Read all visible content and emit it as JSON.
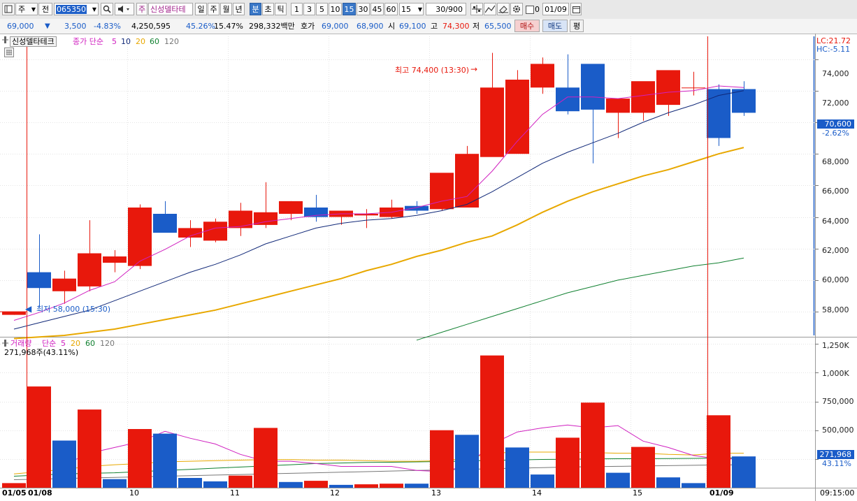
{
  "toolbar": {
    "type_label": "주",
    "period_label": "전",
    "code": "065350",
    "stock_name": "신성델타테",
    "stock_tag": "주",
    "period_buttons": [
      "일",
      "주",
      "월",
      "년",
      "분",
      "초",
      "틱"
    ],
    "interval_buttons": [
      "1",
      "3",
      "5",
      "10",
      "15",
      "30",
      "45",
      "60"
    ],
    "interval_value": "15",
    "count": "30/900",
    "count_checkbox_value": "0",
    "date": "01/09"
  },
  "quote": {
    "price": "69,000",
    "change": "3,500",
    "change_pct": "-4.83%",
    "volume": "4,250,595",
    "rate1": "45.26%",
    "rate2": "15.47%",
    "amount": "298,332백만",
    "ask_label": "호가",
    "ask": "69,000",
    "bid": "68,900",
    "open_label": "시",
    "open": "69,100",
    "high_label": "고",
    "high": "74,300",
    "low_label": "저",
    "low": "65,500",
    "buy_button": "매수",
    "sell_button": "매도",
    "eval_button": "평"
  },
  "price_panel": {
    "stock_label": "신성델타테크",
    "legend_prefix": "종가 단순",
    "legend_ma": [
      {
        "period": "5",
        "color": "#d020c0"
      },
      {
        "period": "10",
        "color": "#102878"
      },
      {
        "period": "20",
        "color": "#e8a800"
      },
      {
        "period": "60",
        "color": "#108030"
      },
      {
        "period": "120",
        "color": "#777777"
      }
    ],
    "max_annotation": "최고 74,400 (13:30)",
    "min_annotation": "최저 58,000 (15:30)",
    "lc_label": "LC:21.72",
    "hc_label": "HC:-5.11",
    "last_price_tag": "70,600",
    "last_change_tag": "-2.62%",
    "y_ticks": [
      "74,000",
      "72,000",
      "70,000",
      "68,000",
      "66,000",
      "64,000",
      "62,000",
      "60,000",
      "58,000"
    ]
  },
  "volume_panel": {
    "legend_title": "거래량",
    "legend_prefix": "단순",
    "legend_ma": [
      {
        "period": "5",
        "color": "#d020c0"
      },
      {
        "period": "20",
        "color": "#e8a800"
      },
      {
        "period": "60",
        "color": "#108030"
      },
      {
        "period": "120",
        "color": "#777777"
      }
    ],
    "info": "271,968주(43.11%)",
    "last_volume_tag": "271,968",
    "last_pct_tag": "43.11%",
    "y_ticks": [
      "1,250K",
      "1,000K",
      "750,000",
      "500,000",
      "250,000"
    ]
  },
  "x_axis": {
    "ticks": [
      "01/05",
      "01/08",
      "10",
      "11",
      "12",
      "13",
      "14",
      "15",
      "01/09"
    ],
    "time_label": "09:15:00"
  },
  "colors": {
    "up": "#e8180c",
    "down": "#1a5cc8",
    "ma5": "#d020c0",
    "ma10": "#102878",
    "ma20": "#e8a800",
    "ma60": "#108030",
    "ma120": "#777777"
  },
  "chart_data": [
    {
      "type": "candlestick",
      "title": "신성델타테크",
      "interval": "15",
      "categories": [
        "01/05 15:15",
        "01/08 09:00",
        "01/08 09:15",
        "01/08 09:30",
        "01/08 09:45",
        "01/08 10:00",
        "01/08 10:15",
        "01/08 10:30",
        "01/08 10:45",
        "01/08 11:00",
        "01/08 11:15",
        "01/08 11:30",
        "01/08 11:45",
        "01/08 12:00",
        "01/08 12:15",
        "01/08 12:30",
        "01/08 12:45",
        "01/08 13:00",
        "01/08 13:15",
        "01/08 13:30",
        "01/08 13:45",
        "01/08 14:00",
        "01/08 14:15",
        "01/08 14:30",
        "01/08 14:45",
        "01/08 15:00",
        "01/08 15:15",
        "01/08 15:30",
        "01/09 09:00",
        "01/09 09:15"
      ],
      "open": [
        57800,
        60500,
        59300,
        59600,
        61100,
        60900,
        64200,
        62700,
        62500,
        63300,
        63500,
        64200,
        64600,
        64000,
        64100,
        64000,
        64700,
        64500,
        64600,
        67800,
        68000,
        72200,
        72200,
        73700,
        70600,
        70600,
        71100,
        72200,
        72100,
        72100
      ],
      "high": [
        58000,
        62900,
        60600,
        63800,
        61900,
        64800,
        65000,
        63800,
        63900,
        64900,
        66200,
        65000,
        65400,
        64300,
        64500,
        65100,
        65000,
        66700,
        68500,
        74400,
        73300,
        74100,
        74300,
        72000,
        70700,
        71600,
        72800,
        73200,
        72400,
        72600
      ],
      "low": [
        57800,
        58300,
        58500,
        59300,
        60500,
        60700,
        63100,
        62100,
        62400,
        62800,
        63300,
        63800,
        63700,
        63500,
        63300,
        63900,
        64200,
        64400,
        66300,
        67900,
        71400,
        71800,
        70500,
        67400,
        69000,
        70100,
        70400,
        71700,
        68500,
        70400
      ],
      "close": [
        58000,
        59500,
        60100,
        61700,
        61500,
        64600,
        63000,
        63300,
        63700,
        64400,
        64300,
        65000,
        64000,
        64400,
        64200,
        64600,
        64400,
        66800,
        68000,
        72200,
        72700,
        73700,
        70700,
        70800,
        71500,
        72600,
        73300,
        72200,
        69000,
        70600
      ],
      "ma": {
        "5": [
          57450,
          57950,
          58550,
          59350,
          59900,
          61200,
          61950,
          62800,
          63300,
          63400,
          63700,
          63900,
          64100,
          64200,
          64200,
          64300,
          64600,
          65000,
          65300,
          66900,
          68800,
          70500,
          71600,
          71600,
          71500,
          71700,
          71900,
          72000,
          72300,
          72200
        ],
        "10": [
          56900,
          57300,
          57700,
          58100,
          58700,
          59300,
          59900,
          60500,
          61000,
          61600,
          62300,
          62800,
          63300,
          63600,
          63800,
          63900,
          64100,
          64400,
          64800,
          65600,
          66500,
          67400,
          68100,
          68700,
          69300,
          70000,
          70600,
          71100,
          71700,
          72000
        ],
        "20": [
          56300,
          56400,
          56500,
          56700,
          56900,
          57200,
          57500,
          57800,
          58100,
          58500,
          58900,
          59300,
          59700,
          60100,
          60600,
          61000,
          61500,
          61900,
          62400,
          62800,
          63500,
          64300,
          65000,
          65600,
          66100,
          66600,
          67000,
          67500,
          68000,
          68400
        ],
        "60": [
          null,
          null,
          null,
          null,
          null,
          null,
          null,
          null,
          null,
          null,
          null,
          null,
          null,
          null,
          null,
          null,
          56200,
          56700,
          57200,
          57700,
          58200,
          58700,
          59200,
          59600,
          60000,
          60300,
          60600,
          60900,
          61100,
          61400
        ]
      },
      "y_axis": {
        "range": [
          56500,
          75000
        ],
        "ticks": [
          58000,
          60000,
          62000,
          64000,
          66000,
          68000,
          70000,
          72000,
          74000
        ]
      },
      "annotations": {
        "max": "최고 74,400 (13:30)",
        "min": "최저 58,000 (15:30)"
      }
    },
    {
      "type": "bar",
      "title": "거래량",
      "categories": [
        "01/05 15:15",
        "01/08 09:00",
        "01/08 09:15",
        "01/08 09:30",
        "01/08 09:45",
        "01/08 10:00",
        "01/08 10:15",
        "01/08 10:30",
        "01/08 10:45",
        "01/08 11:00",
        "01/08 11:15",
        "01/08 11:30",
        "01/08 11:45",
        "01/08 12:00",
        "01/08 12:15",
        "01/08 12:30",
        "01/08 12:45",
        "01/08 13:00",
        "01/08 13:15",
        "01/08 13:30",
        "01/08 13:45",
        "01/08 14:00",
        "01/08 14:15",
        "01/08 14:30",
        "01/08 14:45",
        "01/08 15:00",
        "01/08 15:15",
        "01/08 15:30",
        "01/09 09:00",
        "01/09 09:15"
      ],
      "values": [
        40000,
        880000,
        410000,
        680000,
        75000,
        510000,
        470000,
        85000,
        55000,
        105000,
        520000,
        50000,
        60000,
        25000,
        30000,
        35000,
        35000,
        500000,
        460000,
        1150000,
        350000,
        115000,
        435000,
        740000,
        130000,
        355000,
        90000,
        40000,
        630000,
        272000
      ],
      "direction": [
        "up",
        "up",
        "down",
        "up",
        "down",
        "up",
        "down",
        "down",
        "down",
        "up",
        "up",
        "down",
        "up",
        "down",
        "up",
        "up",
        "down",
        "up",
        "down",
        "up",
        "down",
        "down",
        "up",
        "up",
        "down",
        "up",
        "down",
        "down",
        "up",
        "down"
      ],
      "ma": {
        "5": [
          null,
          null,
          200000,
          300000,
          350000,
          400000,
          490000,
          430000,
          380000,
          290000,
          230000,
          230000,
          210000,
          185000,
          185000,
          185000,
          150000,
          140000,
          190000,
          380000,
          485000,
          520000,
          545000,
          520000,
          540000,
          405000,
          350000,
          280000,
          250000,
          250000
        ],
        "20": [
          120000,
          140000,
          160000,
          185000,
          200000,
          210000,
          225000,
          230000,
          235000,
          240000,
          245000,
          245000,
          240000,
          240000,
          235000,
          230000,
          230000,
          235000,
          255000,
          300000,
          310000,
          310000,
          310000,
          305000,
          300000,
          300000,
          290000,
          285000,
          300000,
          300000
        ],
        "60": [
          100000,
          110000,
          120000,
          125000,
          130000,
          140000,
          150000,
          160000,
          170000,
          180000,
          190000,
          200000,
          210000,
          215000,
          220000,
          222000,
          225000,
          228000,
          232000,
          238000,
          242000,
          246000,
          248000,
          250000,
          252000,
          253000,
          254000,
          255000,
          258000,
          260000
        ],
        "120": [
          70000,
          75000,
          80000,
          85000,
          90000,
          95000,
          100000,
          105000,
          110000,
          115000,
          120000,
          125000,
          130000,
          135000,
          140000,
          145000,
          150000,
          155000,
          160000,
          165000,
          170000,
          175000,
          180000,
          183000,
          186000,
          189000,
          192000,
          195000,
          198000,
          200000
        ]
      },
      "y_axis": {
        "range": [
          0,
          1300000
        ],
        "ticks": [
          250000,
          500000,
          750000,
          1000000,
          1250000
        ]
      }
    }
  ]
}
